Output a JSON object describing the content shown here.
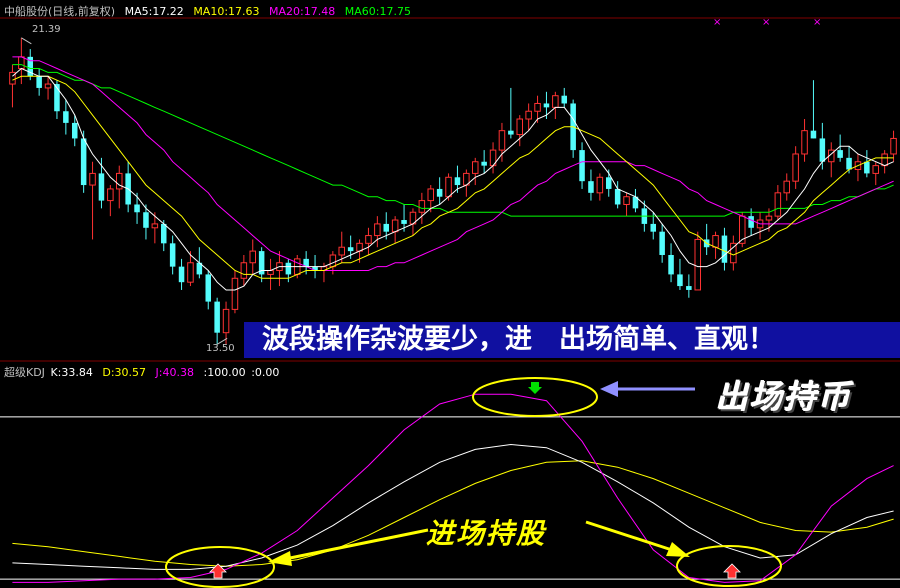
{
  "header": {
    "title": "中船股份(日线,前复权)",
    "ma5": "MA5:17.22",
    "ma10": "MA10:17.63",
    "ma20": "MA20:17.48",
    "ma60": "MA60:17.75"
  },
  "kdj_header": {
    "title": "超级KDJ",
    "k": "K:33.84",
    "d": "D:30.57",
    "j": "J:40.38",
    "level100": ":100.00",
    "level0": ":0.00"
  },
  "labels": {
    "high": "21.39",
    "low": "13.50"
  },
  "annotations": {
    "banner": "波段操作杂波要少，进　出场简单、直观！",
    "exit_text": "出场持币",
    "enter_text": "进场持股"
  },
  "colors": {
    "up": "#ff3232",
    "down": "#54fcfc",
    "ma5": "#ffffff",
    "ma10": "#ffff00",
    "ma20": "#ff00ff",
    "ma60": "#00ff00",
    "k": "#ffffff",
    "d": "#ffff00",
    "j": "#ff00ff",
    "separator": "#800000",
    "ellipse": "#ffff00",
    "exit_arrow": "#9090ff"
  },
  "chart_data": [
    {
      "type": "candlestick",
      "name": "price",
      "ylim": [
        13.2,
        21.9
      ],
      "ohlc": [
        [
          20.2,
          20.7,
          19.6,
          20.5
        ],
        [
          20.6,
          21.39,
          20.2,
          20.9
        ],
        [
          20.9,
          21.1,
          20.3,
          20.4
        ],
        [
          20.4,
          20.6,
          19.9,
          20.1
        ],
        [
          20.1,
          20.4,
          19.8,
          20.2
        ],
        [
          20.2,
          20.3,
          19.3,
          19.5
        ],
        [
          19.5,
          19.8,
          18.9,
          19.2
        ],
        [
          19.2,
          19.4,
          18.6,
          18.8
        ],
        [
          18.8,
          19.0,
          17.4,
          17.6
        ],
        [
          17.6,
          18.2,
          16.2,
          17.9
        ],
        [
          17.9,
          18.3,
          17.0,
          17.2
        ],
        [
          17.2,
          17.6,
          16.8,
          17.5
        ],
        [
          17.5,
          18.1,
          17.0,
          17.9
        ],
        [
          17.9,
          18.2,
          16.9,
          17.1
        ],
        [
          17.1,
          17.4,
          16.6,
          16.9
        ],
        [
          16.9,
          17.1,
          16.2,
          16.5
        ],
        [
          16.5,
          16.9,
          16.1,
          16.6
        ],
        [
          16.6,
          16.7,
          15.9,
          16.1
        ],
        [
          16.1,
          16.3,
          15.3,
          15.5
        ],
        [
          15.5,
          15.7,
          14.9,
          15.1
        ],
        [
          15.1,
          15.9,
          15.0,
          15.6
        ],
        [
          15.6,
          16.0,
          15.2,
          15.3
        ],
        [
          15.3,
          15.4,
          14.4,
          14.6
        ],
        [
          14.6,
          14.7,
          13.5,
          13.8
        ],
        [
          13.8,
          14.6,
          13.5,
          14.4
        ],
        [
          14.4,
          15.4,
          14.3,
          15.2
        ],
        [
          15.2,
          15.8,
          15.0,
          15.6
        ],
        [
          15.6,
          16.2,
          15.3,
          15.9
        ],
        [
          15.9,
          16.0,
          15.1,
          15.3
        ],
        [
          15.3,
          15.7,
          14.9,
          15.4
        ],
        [
          15.4,
          15.9,
          15.0,
          15.6
        ],
        [
          15.6,
          15.7,
          15.1,
          15.3
        ],
        [
          15.3,
          15.8,
          15.2,
          15.7
        ],
        [
          15.7,
          15.9,
          15.3,
          15.5
        ],
        [
          15.5,
          15.8,
          15.2,
          15.4
        ],
        [
          15.4,
          15.6,
          15.1,
          15.5
        ],
        [
          15.5,
          15.9,
          15.3,
          15.8
        ],
        [
          15.8,
          16.4,
          15.6,
          16.0
        ],
        [
          16.0,
          16.3,
          15.7,
          15.9
        ],
        [
          15.9,
          16.2,
          15.6,
          16.1
        ],
        [
          16.1,
          16.5,
          15.8,
          16.3
        ],
        [
          16.3,
          16.8,
          16.0,
          16.6
        ],
        [
          16.6,
          16.9,
          16.2,
          16.4
        ],
        [
          16.4,
          16.8,
          16.1,
          16.7
        ],
        [
          16.7,
          17.1,
          16.4,
          16.6
        ],
        [
          16.6,
          17.0,
          16.3,
          16.9
        ],
        [
          16.9,
          17.4,
          16.6,
          17.2
        ],
        [
          17.2,
          17.6,
          16.9,
          17.5
        ],
        [
          17.5,
          17.8,
          17.1,
          17.3
        ],
        [
          17.3,
          17.9,
          17.2,
          17.8
        ],
        [
          17.8,
          18.1,
          17.4,
          17.6
        ],
        [
          17.6,
          18.0,
          17.3,
          17.9
        ],
        [
          17.9,
          18.3,
          17.6,
          18.2
        ],
        [
          18.2,
          18.5,
          17.9,
          18.1
        ],
        [
          18.1,
          18.7,
          17.9,
          18.5
        ],
        [
          18.5,
          19.2,
          18.2,
          19.0
        ],
        [
          19.0,
          20.1,
          18.8,
          18.9
        ],
        [
          18.9,
          19.4,
          18.6,
          19.3
        ],
        [
          19.3,
          19.7,
          19.0,
          19.5
        ],
        [
          19.5,
          19.9,
          19.2,
          19.7
        ],
        [
          19.7,
          20.0,
          19.3,
          19.6
        ],
        [
          19.6,
          20.0,
          19.3,
          19.9
        ],
        [
          19.9,
          20.1,
          19.6,
          19.7
        ],
        [
          19.7,
          19.8,
          18.3,
          18.5
        ],
        [
          18.5,
          18.7,
          17.5,
          17.7
        ],
        [
          17.7,
          18.0,
          17.2,
          17.4
        ],
        [
          17.4,
          17.9,
          17.2,
          17.8
        ],
        [
          17.8,
          18.0,
          17.3,
          17.5
        ],
        [
          17.5,
          17.7,
          17.0,
          17.1
        ],
        [
          17.1,
          17.4,
          16.8,
          17.3
        ],
        [
          17.3,
          17.5,
          16.9,
          17.0
        ],
        [
          17.0,
          17.2,
          16.4,
          16.6
        ],
        [
          16.6,
          16.9,
          16.2,
          16.4
        ],
        [
          16.4,
          16.6,
          15.6,
          15.8
        ],
        [
          15.8,
          16.1,
          15.1,
          15.3
        ],
        [
          15.3,
          15.7,
          14.9,
          15.0
        ],
        [
          15.0,
          15.3,
          14.7,
          14.9
        ],
        [
          14.9,
          16.4,
          14.9,
          16.2
        ],
        [
          16.2,
          16.6,
          15.8,
          16.0
        ],
        [
          16.0,
          16.4,
          15.7,
          16.3
        ],
        [
          16.3,
          16.5,
          15.4,
          15.6
        ],
        [
          15.6,
          16.3,
          15.4,
          16.1
        ],
        [
          16.1,
          16.9,
          16.0,
          16.8
        ],
        [
          16.8,
          17.0,
          16.3,
          16.5
        ],
        [
          16.5,
          16.9,
          16.2,
          16.7
        ],
        [
          16.7,
          17.0,
          16.4,
          16.8
        ],
        [
          16.8,
          17.6,
          16.7,
          17.4
        ],
        [
          17.4,
          17.9,
          17.2,
          17.7
        ],
        [
          17.7,
          18.6,
          17.5,
          18.4
        ],
        [
          18.4,
          19.3,
          18.2,
          19.0
        ],
        [
          19.0,
          20.3,
          18.8,
          18.8
        ],
        [
          18.8,
          19.2,
          18.0,
          18.2
        ],
        [
          18.2,
          18.7,
          17.8,
          18.5
        ],
        [
          18.5,
          18.9,
          18.2,
          18.3
        ],
        [
          18.3,
          18.6,
          17.9,
          18.0
        ],
        [
          18.0,
          18.4,
          17.7,
          18.2
        ],
        [
          18.2,
          18.5,
          17.8,
          17.9
        ],
        [
          17.9,
          18.2,
          17.6,
          18.1
        ],
        [
          18.1,
          18.5,
          17.9,
          18.4
        ],
        [
          18.4,
          19.0,
          18.2,
          18.8
        ]
      ],
      "ma5": [
        20.4,
        20.6,
        20.5,
        20.4,
        20.4,
        20.1,
        19.8,
        19.4,
        18.8,
        18.4,
        18.1,
        17.8,
        17.6,
        17.5,
        17.3,
        17.0,
        16.8,
        16.6,
        16.4,
        16.1,
        15.8,
        15.6,
        15.4,
        15.1,
        14.9,
        14.9,
        15.0,
        15.3,
        15.4,
        15.4,
        15.5,
        15.5,
        15.5,
        15.5,
        15.5,
        15.5,
        15.6,
        15.7,
        15.8,
        15.9,
        16.0,
        16.2,
        16.3,
        16.4,
        16.5,
        16.6,
        16.8,
        17.0,
        17.1,
        17.3,
        17.5,
        17.6,
        17.8,
        17.9,
        18.1,
        18.4,
        18.6,
        18.8,
        19.0,
        19.3,
        19.4,
        19.6,
        19.6,
        19.3,
        18.9,
        18.5,
        18.2,
        17.9,
        17.5,
        17.4,
        17.3,
        17.1,
        16.9,
        16.6,
        16.3,
        15.9,
        15.6,
        15.5,
        15.5,
        15.6,
        15.8,
        16.0,
        16.2,
        16.3,
        16.4,
        16.5,
        16.7,
        16.9,
        17.2,
        17.5,
        17.9,
        18.2,
        18.4,
        18.6,
        18.6,
        18.4,
        18.3,
        18.2,
        18.1,
        18.2
      ],
      "ma10": [
        20.3,
        20.4,
        20.4,
        20.4,
        20.4,
        20.3,
        20.2,
        20.0,
        19.7,
        19.4,
        19.1,
        18.8,
        18.5,
        18.2,
        17.9,
        17.6,
        17.4,
        17.2,
        17.0,
        16.8,
        16.5,
        16.2,
        16.0,
        15.8,
        15.6,
        15.4,
        15.3,
        15.3,
        15.2,
        15.2,
        15.2,
        15.2,
        15.3,
        15.4,
        15.4,
        15.4,
        15.5,
        15.6,
        15.6,
        15.7,
        15.8,
        15.9,
        16.0,
        16.1,
        16.2,
        16.3,
        16.5,
        16.6,
        16.8,
        16.9,
        17.0,
        17.2,
        17.4,
        17.5,
        17.7,
        17.9,
        18.1,
        18.3,
        18.4,
        18.6,
        18.8,
        19.0,
        19.1,
        19.1,
        19.0,
        18.9,
        18.8,
        18.6,
        18.4,
        18.2,
        18.0,
        17.8,
        17.6,
        17.3,
        17.0,
        16.7,
        16.4,
        16.3,
        16.1,
        16.0,
        15.9,
        15.8,
        15.9,
        16.0,
        16.1,
        16.2,
        16.4,
        16.5,
        16.7,
        16.9,
        17.2,
        17.4,
        17.6,
        17.8,
        18.0,
        18.1,
        18.2,
        18.3,
        18.3,
        18.3
      ],
      "ma20": [
        20.9,
        20.9,
        20.8,
        20.8,
        20.7,
        20.6,
        20.5,
        20.4,
        20.3,
        20.2,
        20.0,
        19.8,
        19.6,
        19.4,
        19.2,
        18.9,
        18.7,
        18.5,
        18.2,
        18.0,
        17.8,
        17.6,
        17.4,
        17.1,
        16.9,
        16.7,
        16.5,
        16.3,
        16.1,
        15.9,
        15.8,
        15.7,
        15.6,
        15.5,
        15.4,
        15.4,
        15.4,
        15.4,
        15.4,
        15.4,
        15.4,
        15.5,
        15.5,
        15.6,
        15.6,
        15.7,
        15.8,
        15.9,
        16.0,
        16.1,
        16.2,
        16.4,
        16.5,
        16.6,
        16.7,
        16.9,
        17.1,
        17.2,
        17.4,
        17.6,
        17.7,
        17.9,
        18.0,
        18.1,
        18.2,
        18.2,
        18.2,
        18.2,
        18.2,
        18.2,
        18.1,
        18.1,
        18.0,
        17.9,
        17.8,
        17.7,
        17.5,
        17.4,
        17.2,
        17.1,
        17.0,
        16.9,
        16.8,
        16.7,
        16.6,
        16.6,
        16.6,
        16.6,
        16.6,
        16.7,
        16.8,
        16.9,
        17.0,
        17.1,
        17.2,
        17.3,
        17.4,
        17.5,
        17.6,
        17.7
      ],
      "ma60": [
        20.7,
        20.7,
        20.6,
        20.6,
        20.5,
        20.5,
        20.4,
        20.3,
        20.3,
        20.2,
        20.1,
        20.1,
        20.0,
        19.9,
        19.8,
        19.7,
        19.6,
        19.5,
        19.4,
        19.3,
        19.2,
        19.1,
        19.0,
        18.9,
        18.8,
        18.7,
        18.6,
        18.5,
        18.4,
        18.3,
        18.2,
        18.1,
        18.0,
        17.9,
        17.8,
        17.7,
        17.6,
        17.6,
        17.5,
        17.4,
        17.3,
        17.3,
        17.2,
        17.2,
        17.1,
        17.1,
        17.0,
        17.0,
        17.0,
        16.9,
        16.9,
        16.9,
        16.9,
        16.9,
        16.9,
        16.9,
        16.8,
        16.8,
        16.8,
        16.8,
        16.8,
        16.8,
        16.8,
        16.8,
        16.8,
        16.8,
        16.8,
        16.8,
        16.8,
        16.8,
        16.8,
        16.8,
        16.8,
        16.8,
        16.8,
        16.8,
        16.8,
        16.8,
        16.8,
        16.8,
        16.8,
        16.9,
        16.9,
        16.9,
        16.9,
        16.9,
        17.0,
        17.0,
        17.0,
        17.0,
        17.1,
        17.1,
        17.2,
        17.2,
        17.3,
        17.3,
        17.4,
        17.5,
        17.5,
        17.6
      ]
    },
    {
      "type": "line",
      "name": "super-kdj",
      "ylim": [
        -3,
        124
      ],
      "x": [
        0,
        4,
        8,
        12,
        16,
        20,
        24,
        28,
        32,
        36,
        40,
        44,
        48,
        52,
        56,
        60,
        64,
        68,
        72,
        76,
        80,
        84,
        88,
        92,
        96,
        99
      ],
      "k": [
        10,
        9,
        8,
        7,
        6,
        6,
        8,
        13,
        21,
        33,
        47,
        60,
        72,
        80,
        83,
        81,
        72,
        60,
        47,
        32,
        20,
        13,
        15,
        28,
        38,
        42
      ],
      "d": [
        22,
        20,
        17,
        14,
        11,
        9,
        8,
        9,
        12,
        18,
        27,
        38,
        49,
        59,
        67,
        72,
        73,
        69,
        62,
        53,
        44,
        35,
        30,
        29,
        32,
        37
      ],
      "j": [
        -2,
        -2,
        -1,
        0,
        0,
        1,
        6,
        16,
        30,
        50,
        70,
        92,
        108,
        114,
        114,
        110,
        85,
        50,
        18,
        1,
        -2,
        -1,
        15,
        45,
        62,
        70
      ],
      "levels": [
        100,
        0
      ]
    }
  ]
}
